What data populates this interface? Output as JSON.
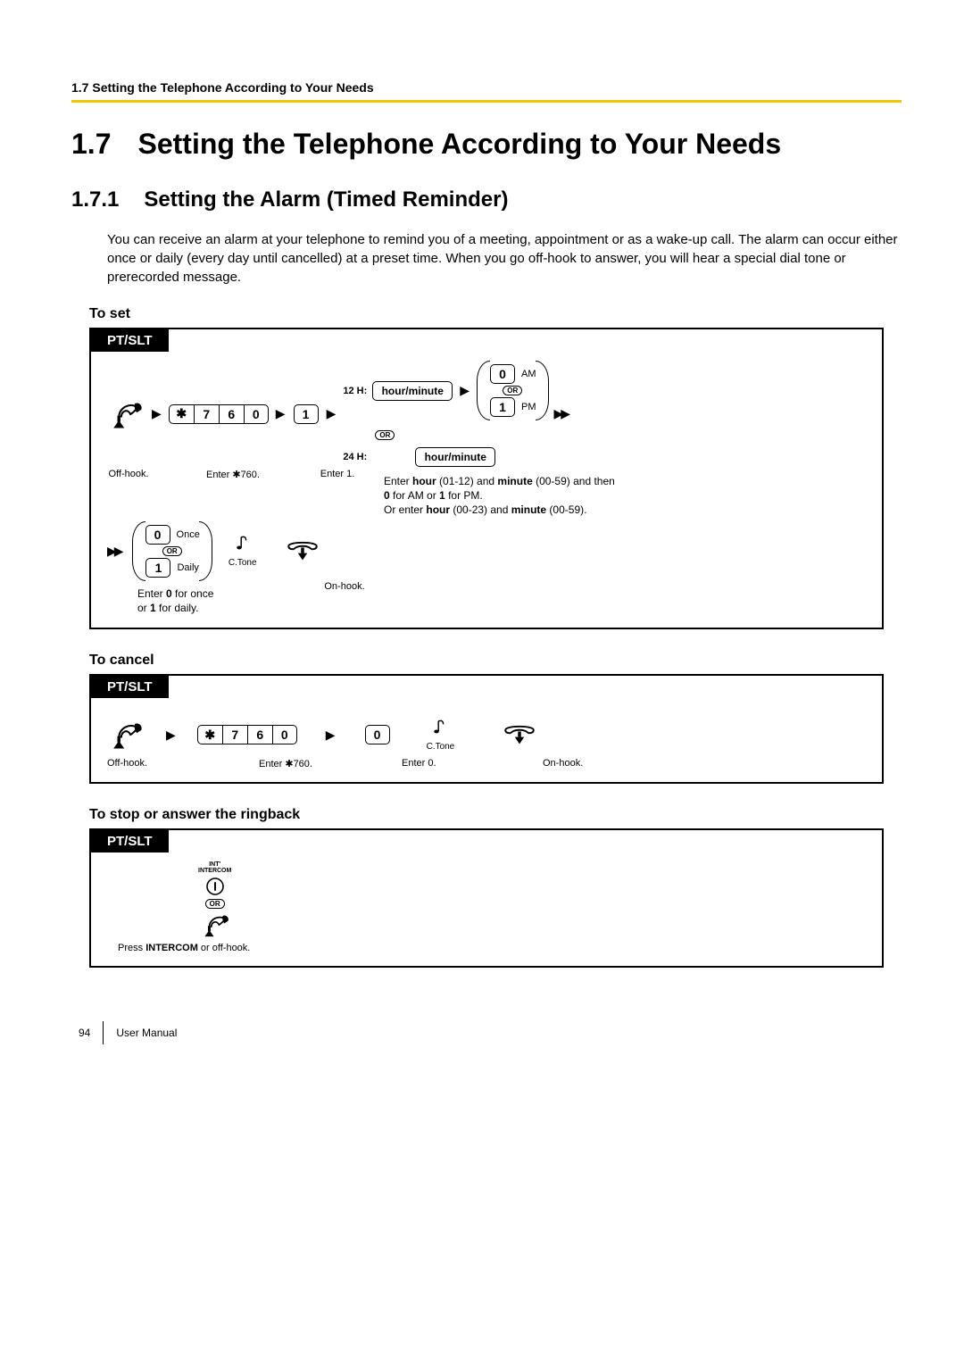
{
  "header": "1.7 Setting the Telephone According to Your Needs",
  "h1": {
    "num": "1.7",
    "title": "Setting the Telephone According to Your Needs"
  },
  "h2": {
    "num": "1.7.1",
    "title": "Setting the Alarm (Timed Reminder)"
  },
  "intro": "You can receive an alarm at your telephone to remind you of a meeting, appointment or as a wake-up call. The alarm can occur either once or daily (every day until cancelled) at a preset time. When you go off-hook to answer, you will hear a special dial tone or prerecorded message.",
  "labels": {
    "to_set": "To set",
    "to_cancel": "To cancel",
    "to_stop": "To stop or answer the ringback",
    "tab": "PT/SLT",
    "offhook": "Off-hook.",
    "onhook": "On-hook.",
    "enter_760": "Enter ✱760.",
    "enter_1": "Enter 1.",
    "enter_0": "Enter 0.",
    "ctone": "C.Tone",
    "or": "OR",
    "h12": "12 H:",
    "h24": "24 H:",
    "hm": "hour/minute",
    "am": "AM",
    "pm": "PM",
    "once": "Once",
    "daily": "Daily",
    "intercom_sup": "INT'",
    "intercom": "INTERCOM",
    "press_intercom": "Press INTERCOM or off-hook."
  },
  "keys": {
    "star": "✱",
    "k7": "7",
    "k6": "6",
    "k0": "0",
    "k1": "1"
  },
  "notes": {
    "time_help_l1": "Enter hour (01-12) and minute (00-59) and then",
    "time_help_l2": "0 for AM or 1 for PM.",
    "time_help_l3": "Or enter hour (00-23) and minute (00-59).",
    "freq_help_l1": "Enter 0 for once",
    "freq_help_l2": "or 1 for daily."
  },
  "footer": {
    "page": "94",
    "manual": "User Manual"
  }
}
